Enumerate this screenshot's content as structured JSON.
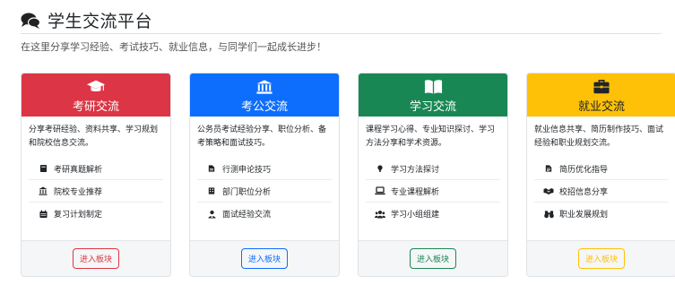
{
  "header": {
    "title": "学生交流平台",
    "subtitle": "在这里分享学习经验、考试技巧、就业信息，与同学们一起成长进步！",
    "icon": "comments-icon"
  },
  "cards": [
    {
      "key": "kaoyan",
      "title": "考研交流",
      "color": "#dc3545",
      "icon": "graduation-cap-icon",
      "desc": "分享考研经验、资料共享、学习规划和院校信息交流。",
      "items": [
        {
          "label": "考研真题解析",
          "icon": "book-icon"
        },
        {
          "label": "院校专业推荐",
          "icon": "university-icon"
        },
        {
          "label": "复习计划制定",
          "icon": "calendar-icon"
        }
      ],
      "button": "进入板块"
    },
    {
      "key": "kaogong",
      "title": "考公交流",
      "color": "#0d6efd",
      "icon": "landmark-icon",
      "desc": "公务员考试经验分享、职位分析、备考策略和面试技巧。",
      "items": [
        {
          "label": "行测申论技巧",
          "icon": "file-icon"
        },
        {
          "label": "部门职位分析",
          "icon": "building-icon"
        },
        {
          "label": "面试经验交流",
          "icon": "user-tie-icon"
        }
      ],
      "button": "进入板块"
    },
    {
      "key": "xuexi",
      "title": "学习交流",
      "color": "#198754",
      "icon": "open-book-icon",
      "desc": "课程学习心得、专业知识探讨、学习方法分享和学术资源。",
      "items": [
        {
          "label": "学习方法探讨",
          "icon": "lightbulb-icon"
        },
        {
          "label": "专业课程解析",
          "icon": "laptop-icon"
        },
        {
          "label": "学习小组组建",
          "icon": "users-icon"
        }
      ],
      "button": "进入板块"
    },
    {
      "key": "jiuye",
      "title": "就业交流",
      "color": "#ffc107",
      "icon": "briefcase-icon",
      "desc": "就业信息共享、简历制作技巧、面试经验和职业规划交流。",
      "items": [
        {
          "label": "简历优化指导",
          "icon": "file-alt-icon"
        },
        {
          "label": "校招信息分享",
          "icon": "handshake-icon"
        },
        {
          "label": "职业发展规划",
          "icon": "binoculars-icon"
        }
      ],
      "button": "进入板块"
    }
  ]
}
